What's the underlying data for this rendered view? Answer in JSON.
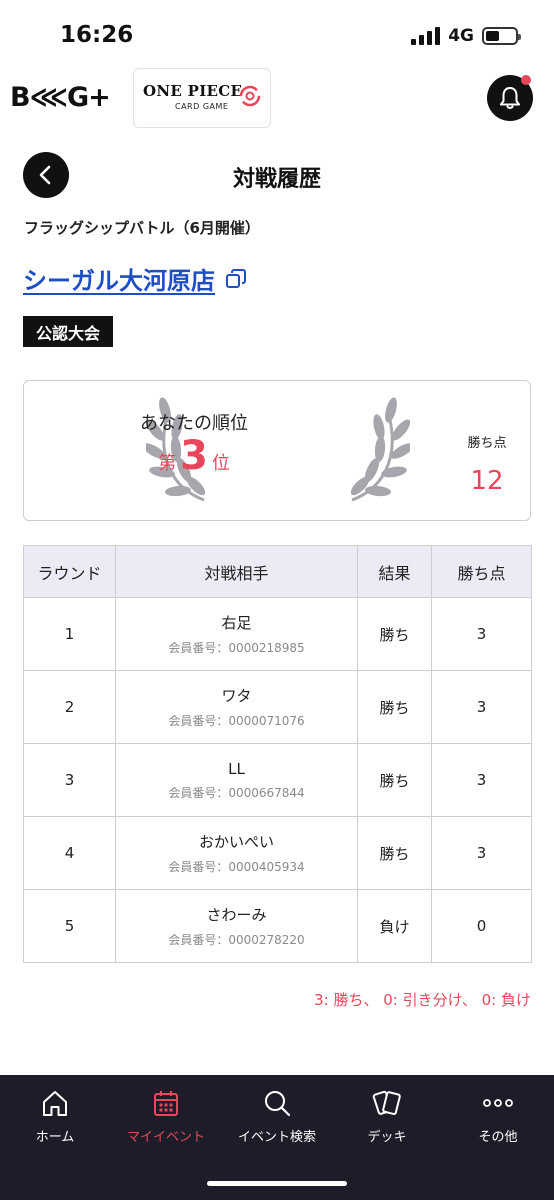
{
  "status_bar": {
    "time": "16:26",
    "network": "4G"
  },
  "header": {
    "brand_logo": "B⋘G+",
    "partner_logo_line1": "ONE PIECE",
    "partner_logo_line2": "CARD GAME",
    "notification_badge": true
  },
  "page": {
    "title": "対戦履歴"
  },
  "event": {
    "name": "フラッグシップバトル（6月開催）",
    "store": "シーガル大河原店",
    "badge": "公認大会"
  },
  "rank": {
    "caption": "あなたの順位",
    "prefix": "第",
    "value": "3",
    "suffix": "位",
    "points_label": "勝ち点",
    "points_value": "12"
  },
  "table": {
    "headers": {
      "round": "ラウンド",
      "opponent": "対戦相手",
      "result": "結果",
      "points": "勝ち点"
    },
    "rows": [
      {
        "round": "1",
        "name": "右足",
        "member_id": "会員番号：0000218985",
        "result": "勝ち",
        "points": "3"
      },
      {
        "round": "2",
        "name": "ワタ",
        "member_id": "会員番号：0000071076",
        "result": "勝ち",
        "points": "3"
      },
      {
        "round": "3",
        "name": "LL",
        "member_id": "会員番号：0000667844",
        "result": "勝ち",
        "points": "3"
      },
      {
        "round": "4",
        "name": "おかいぺい",
        "member_id": "会員番号：0000405934",
        "result": "勝ち",
        "points": "3"
      },
      {
        "round": "5",
        "name": "さわーみ",
        "member_id": "会員番号：0000278220",
        "result": "負け",
        "points": "0"
      }
    ]
  },
  "legend": "3: 勝ち、 0: 引き分け、 0: 負け",
  "nav": {
    "items": [
      {
        "label": "ホーム",
        "icon": "home-icon"
      },
      {
        "label": "マイイベント",
        "icon": "calendar-icon",
        "active": true
      },
      {
        "label": "イベント検索",
        "icon": "search-icon"
      },
      {
        "label": "デッキ",
        "icon": "cards-icon"
      },
      {
        "label": "その他",
        "icon": "more-icon"
      }
    ]
  },
  "colors": {
    "accent": "#e8475b",
    "link": "#1d4ec4",
    "nav_bg": "#1c1d28",
    "table_header_bg": "#ebebf5"
  }
}
